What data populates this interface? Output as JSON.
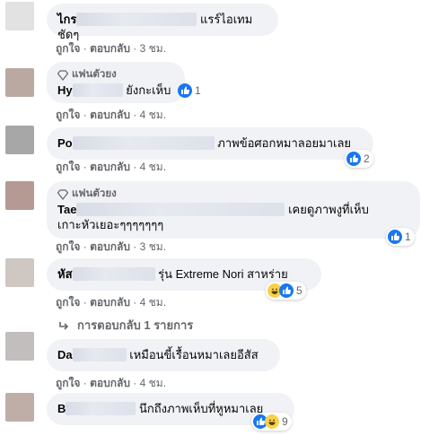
{
  "comments": [
    {
      "name_visible": "ไกร",
      "text": "แรร์ไอเทมชัดๆ",
      "badge": "",
      "actions": {
        "like": "ถูกใจ",
        "reply": "ตอบกลับ",
        "time": "3 ชม."
      },
      "reaction_count": "",
      "avatar_color": "#d9d9d9"
    },
    {
      "name_visible": "Hy",
      "text": "ยังกะเห็บ",
      "badge": "แฟนตัวยง",
      "actions": {
        "like": "ถูกใจ",
        "reply": "ตอบกลับ",
        "time": "4 ชม."
      },
      "reaction_count": "1",
      "avatar_color": "#b9a9a1"
    },
    {
      "name_visible": "Po",
      "text": "ภาพข้อศอกหมาลอยมาเลย",
      "badge": "",
      "actions": {
        "like": "ถูกใจ",
        "reply": "ตอบกลับ",
        "time": "4 ชม."
      },
      "reaction_count": "2",
      "avatar_color": "#a7a7a7"
    },
    {
      "name_visible": "Tae",
      "text_line1": "เคยดูภาพงูที่เห็บ",
      "text_line2": "เกาะหัวเยอะๆๆๆๆๆๆๆ",
      "badge": "แฟนตัวยง",
      "actions": {
        "like": "ถูกใจ",
        "reply": "ตอบกลับ",
        "time": "3 ชม."
      },
      "reaction_count": "1",
      "avatar_color": "#b49a92"
    },
    {
      "name_visible": "หัส",
      "text": "รุ่น Extreme Nori สาหร่าย",
      "badge": "",
      "actions": {
        "like": "ถูกใจ",
        "reply": "ตอบกลับ",
        "time": "4 ชม."
      },
      "reaction_count": "5",
      "avatar_color": "#cfc7c2"
    },
    {
      "name_visible": "Da",
      "text": "เหมือนขี้เรื้อนหมาเลยอีสัส",
      "badge": "",
      "actions": {
        "like": "ถูกใจ",
        "reply": "ตอบกลับ",
        "time": "4 ชม."
      },
      "reaction_count": "",
      "avatar_color": "#c2bebe"
    },
    {
      "name_visible": "B",
      "text": "นึกถึงภาพเห็บที่หูหมาเลย",
      "badge": "",
      "actions": {
        "like": "ถูกใจ",
        "reply": "ตอบกลับ",
        "time": "4 ชม."
      },
      "reaction_count": "9",
      "avatar_color": "#bfaea8"
    }
  ],
  "replies_link": "การตอบกลับ 1 รายการ",
  "colors": {
    "like_blue": "#1877f2",
    "bubble": "#f0f2f5",
    "muted": "#65676b"
  }
}
